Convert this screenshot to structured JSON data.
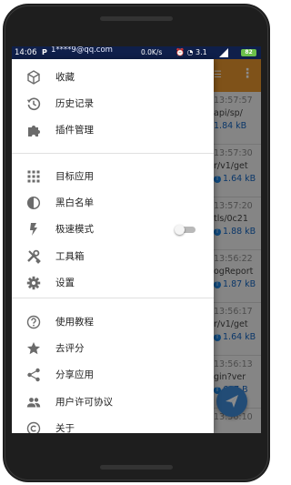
{
  "status_bar": {
    "time": "14:06",
    "p_badge": "P",
    "account": "1****9@qq.com",
    "net_speed": "0.0K/s",
    "sim_label": "3.1",
    "battery": "82"
  },
  "background_app": {
    "rows": [
      {
        "time": "13:57:57",
        "path": "api/sp/",
        "size": "1.84 kB",
        "badge": ""
      },
      {
        "time": "13:57:30",
        "path": "r/v1/get",
        "size": "1.64 kB",
        "badge": "T"
      },
      {
        "time": "13:57:20",
        "path": "tls/0c21",
        "size": "1.88 kB",
        "badge": "T"
      },
      {
        "time": "13:56:22",
        "path": "ogReport",
        "size": "1.87 kB",
        "badge": "T"
      },
      {
        "time": "13:56:17",
        "path": "r/v1/get",
        "size": "1.64 kB",
        "badge": "T"
      },
      {
        "time": "13:56:13",
        "path": "gin?ver",
        "size": "617 B",
        "badge": "T"
      },
      {
        "time": "13:56:10",
        "path": "",
        "size": "",
        "badge": ""
      }
    ]
  },
  "drawer": {
    "group1": [
      {
        "label": "收藏",
        "icon": "cube-icon"
      },
      {
        "label": "历史记录",
        "icon": "history-icon"
      },
      {
        "label": "插件管理",
        "icon": "puzzle-icon"
      }
    ],
    "group2": [
      {
        "label": "目标应用",
        "icon": "apps-grid-icon"
      },
      {
        "label": "黑白名单",
        "icon": "contrast-icon"
      },
      {
        "label": "极速模式",
        "icon": "flash-icon",
        "toggle": false
      },
      {
        "label": "工具箱",
        "icon": "tools-icon"
      },
      {
        "label": "设置",
        "icon": "gear-icon"
      }
    ],
    "group3": [
      {
        "label": "使用教程",
        "icon": "help-icon"
      },
      {
        "label": "去评分",
        "icon": "star-icon"
      },
      {
        "label": "分享应用",
        "icon": "share-icon"
      },
      {
        "label": "用户许可协议",
        "icon": "people-icon"
      },
      {
        "label": "关于",
        "icon": "copyright-icon"
      }
    ]
  },
  "colors": {
    "status_bar": "#0f1f4a",
    "app_bar": "#e8962e",
    "fab": "#3f8ad8",
    "icon": "#6b6b6b"
  }
}
